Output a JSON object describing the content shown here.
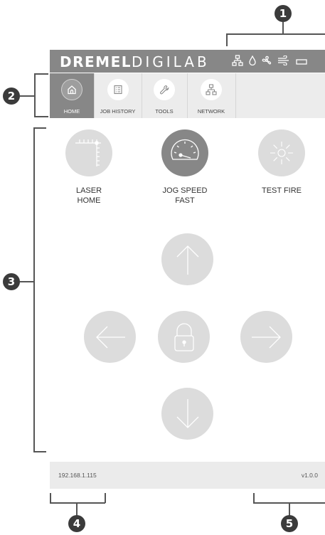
{
  "callouts": {
    "c1": "1",
    "c2": "2",
    "c3": "3",
    "c4": "4",
    "c5": "5"
  },
  "header": {
    "brand_bold": "DREMEL",
    "brand_light": "DIGILAB",
    "status_icons": [
      "network-icon",
      "water-drop-icon",
      "fan-icon",
      "air-flow-icon",
      "battery-icon"
    ]
  },
  "tabs": [
    {
      "label": "HOME",
      "icon": "home-icon",
      "active": true
    },
    {
      "label": "JOB HISTORY",
      "icon": "list-icon",
      "active": false
    },
    {
      "label": "TOOLS",
      "icon": "wrench-icon",
      "active": false
    },
    {
      "label": "NETWORK",
      "icon": "network-icon",
      "active": false
    }
  ],
  "controls": {
    "laser_home": {
      "line1": "LASER",
      "line2": "HOME",
      "icon": "laser-home-icon"
    },
    "jog_speed": {
      "line1": "JOG SPEED",
      "line2": "FAST",
      "icon": "speedometer-icon"
    },
    "test_fire": {
      "label": "TEST FIRE",
      "icon": "sun-burst-icon"
    }
  },
  "jog": {
    "up": "arrow-up-icon",
    "left": "arrow-left-icon",
    "center": "lock-icon",
    "right": "arrow-right-icon",
    "down": "arrow-down-icon"
  },
  "footer": {
    "ip": "192.168.1.115",
    "version": "v1.0.0"
  },
  "colors": {
    "header_bg": "#878787",
    "tab_bg": "#ececec",
    "control_bg": "#dcdcdc",
    "callout_bg": "#3b3b3b"
  }
}
